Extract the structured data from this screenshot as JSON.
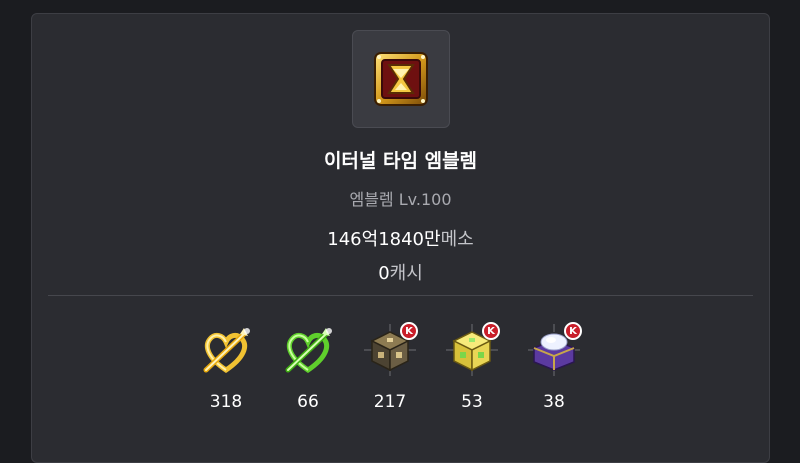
{
  "item": {
    "name": "이터널 타임 엠블렘",
    "subtitle": "엠블렘 Lv.100",
    "icon": "hourglass-emblem-icon"
  },
  "price": {
    "meso_value": "146억1840만",
    "meso_unit": "메소",
    "cash_value": "0",
    "cash_unit": "캐시"
  },
  "materials": [
    {
      "icon": "gold-heart-arrow-icon",
      "count": "318"
    },
    {
      "icon": "green-heart-arrow-icon",
      "count": "66"
    },
    {
      "icon": "dark-cube-icon",
      "count": "217",
      "badge": "K"
    },
    {
      "icon": "yellow-cube-icon",
      "count": "53",
      "badge": "K"
    },
    {
      "icon": "purple-box-icon",
      "count": "38",
      "badge": "K"
    }
  ],
  "colors": {
    "background": "#1b1c20",
    "card": "#2b2c31",
    "badge": "#c81e2a"
  }
}
